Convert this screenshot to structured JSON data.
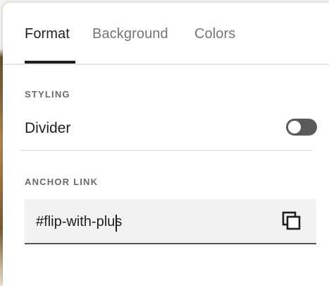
{
  "tabs": [
    {
      "label": "Format",
      "active": true
    },
    {
      "label": "Background",
      "active": false
    },
    {
      "label": "Colors",
      "active": false
    }
  ],
  "styling": {
    "section_label": "STYLING",
    "divider_label": "Divider",
    "divider_enabled": false
  },
  "anchor": {
    "section_label": "ANCHOR LINK",
    "value": "#flip-with-plus"
  },
  "icons": {
    "copy": "copy-icon"
  },
  "colors": {
    "text_primary": "#1f1f1f",
    "text_secondary": "#757575",
    "toggle_off": "#5a5a5a",
    "input_bg": "#f2f2f2"
  }
}
